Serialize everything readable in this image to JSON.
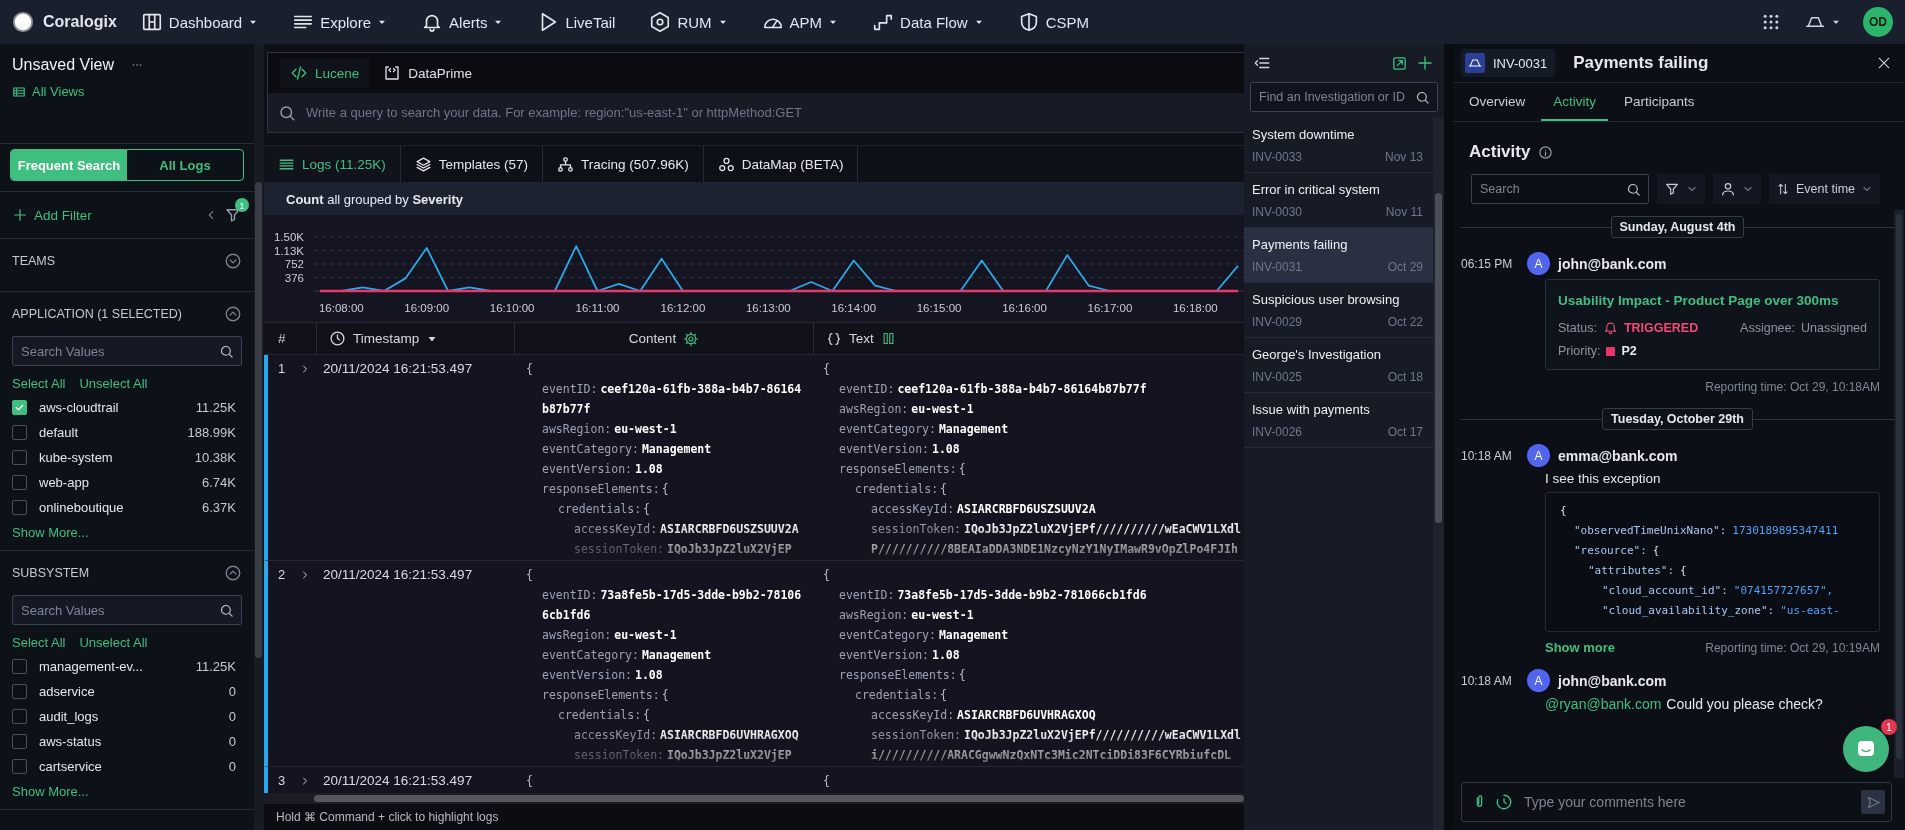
{
  "topbar": {
    "logo": "Coralogix",
    "nav": [
      {
        "label": "Dashboard",
        "menu": true
      },
      {
        "label": "Explore",
        "menu": true
      },
      {
        "label": "Alerts",
        "menu": true
      },
      {
        "label": "LiveTail",
        "menu": false
      },
      {
        "label": "RUM",
        "menu": true
      },
      {
        "label": "APM",
        "menu": true
      },
      {
        "label": "Data Flow",
        "menu": true
      },
      {
        "label": "CSPM",
        "menu": false
      }
    ],
    "avatar": "OD"
  },
  "sidebar": {
    "view_title": "Unsaved View",
    "all_views": "All Views",
    "modes": [
      {
        "label": "Frequent Search",
        "selected": true
      },
      {
        "label": "All Logs",
        "selected": false
      }
    ],
    "add_filter": "Add Filter",
    "filter_count": "1",
    "sections": [
      {
        "title": "TEAMS",
        "expanded": false
      },
      {
        "title": "APPLICATION (1 SELECTED)",
        "expanded": true,
        "placeholder": "Search Values",
        "select_all": "Select All",
        "unselect_all": "Unselect All",
        "values": [
          {
            "label": "aws-cloudtrail",
            "count": "11.25K",
            "checked": true
          },
          {
            "label": "default",
            "count": "188.99K",
            "checked": false
          },
          {
            "label": "kube-system",
            "count": "10.38K",
            "checked": false
          },
          {
            "label": "web-app",
            "count": "6.74K",
            "checked": false
          },
          {
            "label": "onlineboutique",
            "count": "6.37K",
            "checked": false
          }
        ],
        "show_more": "Show More..."
      },
      {
        "title": "SUBSYSTEM",
        "expanded": true,
        "placeholder": "Search Values",
        "select_all": "Select All",
        "unselect_all": "Unselect All",
        "values": [
          {
            "label": "management-ev...",
            "count": "11.25K",
            "checked": false
          },
          {
            "label": "adservice",
            "count": "0",
            "checked": false
          },
          {
            "label": "audit_logs",
            "count": "0",
            "checked": false
          },
          {
            "label": "aws-status",
            "count": "0",
            "checked": false
          },
          {
            "label": "cartservice",
            "count": "0",
            "checked": false
          }
        ],
        "show_more": "Show More..."
      }
    ]
  },
  "query": {
    "languages": [
      {
        "label": "Lucene",
        "selected": true
      },
      {
        "label": "DataPrime",
        "selected": false
      }
    ],
    "placeholder": "Write a query to search your data. For example: region:\"us-east-1\" or httpMethod:GET"
  },
  "view_tabs": [
    {
      "label": "Logs (11.25K)",
      "selected": true
    },
    {
      "label": "Templates (57)",
      "selected": false
    },
    {
      "label": "Tracing (507.96K)",
      "selected": false
    },
    {
      "label": "DataMap (BETA)",
      "selected": false
    }
  ],
  "chart_header": "**Count** all grouped by **Severity**",
  "chart_data": {
    "type": "line",
    "categories": [
      null,
      "16:08:00",
      null,
      null,
      null,
      "16:09:00",
      null,
      null,
      null,
      "16:10:00",
      null,
      null,
      null,
      "16:11:00",
      null,
      null,
      null,
      "16:12:00",
      null,
      null,
      null,
      "16:13:00",
      null,
      null,
      null,
      "16:14:00",
      null,
      null,
      null,
      "16:15:00",
      null,
      null,
      null,
      "16:16:00",
      null,
      null,
      null,
      "16:17:00",
      null,
      null,
      null,
      "16:18:00",
      null,
      null
    ],
    "series": [
      {
        "color": "#2ba8e8",
        "values": [
          0,
          0,
          100,
          0,
          350,
          1200,
          0,
          100,
          0,
          0,
          0,
          0,
          1250,
          0,
          200,
          0,
          900,
          0,
          0,
          0,
          0,
          0,
          0,
          250,
          0,
          850,
          150,
          0,
          0,
          0,
          0,
          850,
          0,
          0,
          0,
          1000,
          150,
          0,
          0,
          0,
          0,
          0,
          0,
          700
        ]
      },
      {
        "color": "#e8386a",
        "values": [
          0,
          0,
          0,
          0,
          0,
          0,
          0,
          0,
          0,
          0,
          0,
          0,
          0,
          0,
          0,
          0,
          0,
          0,
          0,
          0,
          0,
          0,
          0,
          0,
          0,
          0,
          0,
          0,
          0,
          0,
          0,
          0,
          0,
          0,
          0,
          0,
          0,
          0,
          0,
          0,
          0,
          0,
          0,
          0
        ]
      }
    ],
    "ylim": [
      0,
      1504
    ],
    "grid": true,
    "yticks": [
      {
        "value": 376,
        "label": "376"
      },
      {
        "value": 752,
        "label": "752"
      },
      {
        "value": 1128,
        "label": "1.13K"
      },
      {
        "value": 1504,
        "label": "1.50K"
      }
    ]
  },
  "table": {
    "columns": [
      "#",
      "Timestamp",
      "Content",
      "Text"
    ],
    "rows": [
      {
        "number": "1",
        "timestamp": "20/11/2024 16:21:53.497",
        "content": {
          "open": "{",
          "fields": [
            {
              "key": "eventID:",
              "value": "ceef120a-61fb-388a-b4b7-86164b87b77f"
            },
            {
              "key": "awsRegion:",
              "value": "eu-west-1"
            },
            {
              "key": "eventCategory:",
              "value": "Management"
            },
            {
              "key": "eventVersion:",
              "value": "1.08"
            },
            {
              "key": "responseElements:",
              "open": "{",
              "children": [
                {
                  "key": "credentials:",
                  "open": "{",
                  "children": [
                    {
                      "key": "accessKeyId:",
                      "value": "ASIARCRBFD6USZSUUV2A"
                    },
                    {
                      "key": "sessionToken:",
                      "value": "IQoJb3JpZ2luX2VjEP"
                    }
                  ]
                }
              ]
            }
          ]
        },
        "text": {
          "open": "{",
          "fields": [
            {
              "key": "eventID:",
              "value": "ceef120a-61fb-388a-b4b7-86164b87b77f"
            },
            {
              "key": "awsRegion:",
              "value": "eu-west-1"
            },
            {
              "key": "eventCategory:",
              "value": "Management"
            },
            {
              "key": "eventVersion:",
              "value": "1.08"
            },
            {
              "key": "responseElements:",
              "open": "{",
              "children": [
                {
                  "key": "credentials:",
                  "open": "{",
                  "children": [
                    {
                      "key": "accessKeyId:",
                      "value": "ASIARCRBFD6USZSUUV2A"
                    },
                    {
                      "key": "sessionToken:",
                      "value": "IQoJb3JpZ2luX2VjEPf//////////wEaCWV1LXdl",
                      "continued": "P//////////8BEAIaDDA3NDE1NzcyNzY1NyIMawR9vOpZlPo4FJIh"
                    }
                  ]
                }
              ]
            }
          ]
        }
      },
      {
        "number": "2",
        "timestamp": "20/11/2024 16:21:53.497",
        "content": {
          "open": "{",
          "fields": [
            {
              "key": "eventID:",
              "value": "73a8fe5b-17d5-3dde-b9b2-781066cb1fd6"
            },
            {
              "key": "awsRegion:",
              "value": "eu-west-1"
            },
            {
              "key": "eventCategory:",
              "value": "Management"
            },
            {
              "key": "eventVersion:",
              "value": "1.08"
            },
            {
              "key": "responseElements:",
              "open": "{",
              "children": [
                {
                  "key": "credentials:",
                  "open": "{",
                  "children": [
                    {
                      "key": "accessKeyId:",
                      "value": "ASIARCRBFD6UVHRAGXOQ"
                    },
                    {
                      "key": "sessionToken:",
                      "value": "IQoJb3JpZ2luX2VjEP"
                    }
                  ]
                }
              ]
            }
          ]
        },
        "text": {
          "open": "{",
          "fields": [
            {
              "key": "eventID:",
              "value": "73a8fe5b-17d5-3dde-b9b2-781066cb1fd6"
            },
            {
              "key": "awsRegion:",
              "value": "eu-west-1"
            },
            {
              "key": "eventCategory:",
              "value": "Management"
            },
            {
              "key": "eventVersion:",
              "value": "1.08"
            },
            {
              "key": "responseElements:",
              "open": "{",
              "children": [
                {
                  "key": "credentials:",
                  "open": "{",
                  "children": [
                    {
                      "key": "accessKeyId:",
                      "value": "ASIARCRBFD6UVHRAGXOQ"
                    },
                    {
                      "key": "sessionToken:",
                      "value": "IQoJb3JpZ2luX2VjEPf//////////wEaCWV1LXdl",
                      "continued": "i//////////ARACGgwwNzQxNTc3Mic2NTciDDi83F6CYRbiufcDL"
                    }
                  ]
                }
              ]
            }
          ]
        }
      },
      {
        "number": "3",
        "timestamp": "20/11/2024 16:21:53.497",
        "content": {
          "open": "{"
        },
        "text": {
          "open": "{"
        }
      }
    ]
  },
  "footer_hint": "Hold ⌘ Command + click to highlight logs",
  "investigations": {
    "placeholder": "Find an Investigation or ID",
    "items": [
      {
        "title": "System downtime",
        "id": "INV-0033",
        "date": "Nov 13",
        "selected": false
      },
      {
        "title": "Error in critical system",
        "id": "INV-0030",
        "date": "Nov 11",
        "selected": false
      },
      {
        "title": "Payments failing",
        "id": "INV-0031",
        "date": "Oct 29",
        "selected": true
      },
      {
        "title": "Suspicious user browsing",
        "id": "INV-0029",
        "date": "Oct 22",
        "selected": false
      },
      {
        "title": "George's Investigation",
        "id": "INV-0025",
        "date": "Oct 18",
        "selected": false
      },
      {
        "title": "Issue with payments",
        "id": "INV-0026",
        "date": "Oct 17",
        "selected": false
      }
    ]
  },
  "detail": {
    "id": "INV-0031",
    "title": "Payments failing",
    "tabs": [
      {
        "label": "Overview",
        "selected": false
      },
      {
        "label": "Activity",
        "selected": true
      },
      {
        "label": "Participants",
        "selected": false
      }
    ],
    "heading": "Activity",
    "search_placeholder": "Search",
    "sort_label": "Event time",
    "feed": [
      {
        "kind": "date",
        "label": "Sunday, August 4th"
      },
      {
        "kind": "alert",
        "time": "06:15 PM",
        "avatar": "A",
        "author": "john@bank.com",
        "title": "Usability Impact - Product Page over 300ms",
        "status_label": "Status:",
        "status": "TRIGGERED",
        "assignee_label": "Assignee:",
        "assignee": "Unassigned",
        "priority_label": "Priority:",
        "priority": {
          "label": "P2",
          "color": "#e8386a"
        },
        "reporting": "Reporting time: Oct 29, 10:18AM"
      },
      {
        "kind": "date",
        "label": "Tuesday, October 29th"
      },
      {
        "kind": "code",
        "time": "10:18 AM",
        "avatar": "A",
        "author": "emma@bank.com",
        "text": "I see this exception",
        "code": {
          "open": "{",
          "fields": [
            {
              "key": "\"observedTimeUnixNano\":",
              "value": "1730189895347411"
            },
            {
              "key": "\"resource\":",
              "open": "{",
              "children": [
                {
                  "key": "\"attributes\":",
                  "open": "{",
                  "children": [
                    {
                      "key": "\"cloud_account_id\":",
                      "value": "\"074157727657\","
                    },
                    {
                      "key": "\"cloud_availability_zone\":",
                      "value": "\"us-east-"
                    }
                  ]
                }
              ]
            }
          ]
        },
        "show_more": "Show more",
        "reporting": "Reporting time: Oct 29, 10:19AM"
      },
      {
        "kind": "mention",
        "time": "10:18 AM",
        "avatar": "A",
        "author": "john@bank.com",
        "mention": "@ryan@bank.com",
        "text": "Could you please check?"
      }
    ],
    "comment_placeholder": "Type your comments here",
    "chat_badge": "1"
  }
}
